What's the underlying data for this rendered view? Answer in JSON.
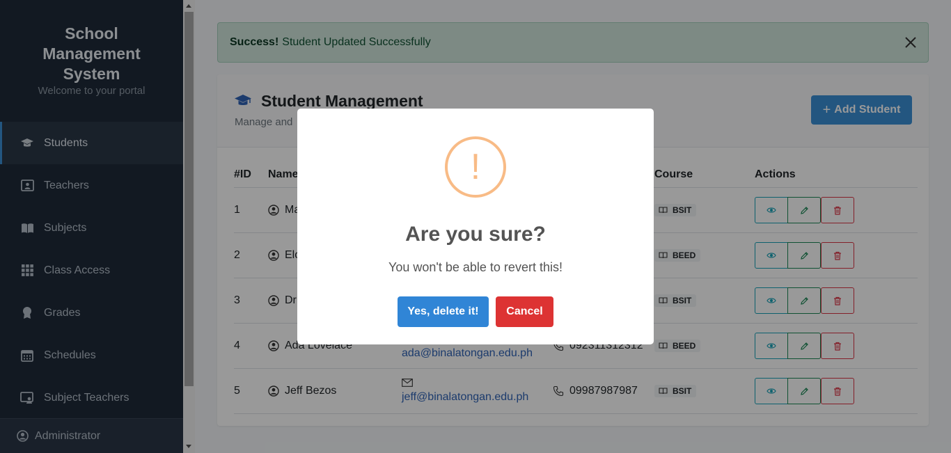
{
  "brand": {
    "title_line1": "School",
    "title_line2": "Management",
    "title_line3": "System",
    "subtitle": "Welcome to your portal"
  },
  "sidebar": {
    "items": [
      {
        "label": "Students",
        "icon": "graduation-cap-icon",
        "active": true
      },
      {
        "label": "Teachers",
        "icon": "teacher-board-icon"
      },
      {
        "label": "Subjects",
        "icon": "book-open-icon"
      },
      {
        "label": "Class Access",
        "icon": "grid-icon"
      },
      {
        "label": "Grades",
        "icon": "award-icon"
      },
      {
        "label": "Schedules",
        "icon": "calendar-icon"
      },
      {
        "label": "Subject Teachers",
        "icon": "monitor-user-icon"
      }
    ],
    "footer_label": "Administrator"
  },
  "alert": {
    "strong": "Success!",
    "message": "Student Updated Successfully"
  },
  "card": {
    "title": "Student Management",
    "subtitle": "Manage and",
    "add_button": "Add Student"
  },
  "table": {
    "headers": {
      "id": "#ID",
      "name": "Name",
      "course": "Course",
      "actions": "Actions"
    },
    "rows": [
      {
        "id": "1",
        "name": "Ma",
        "course": "BSIT"
      },
      {
        "id": "2",
        "name": "Elo",
        "course": "BEED"
      },
      {
        "id": "3",
        "name": "Dr",
        "course": "BSIT"
      },
      {
        "id": "4",
        "name": "Ada Lovelace",
        "email": "ada@binalatongan.edu.ph",
        "phone": "092311312312",
        "course": "BEED"
      },
      {
        "id": "5",
        "name": "Jeff Bezos",
        "email": "jeff@binalatongan.edu.ph",
        "phone": "09987987987",
        "course": "BSIT"
      }
    ]
  },
  "modal": {
    "icon": "!",
    "title": "Are you sure?",
    "text": "You won't be able to revert this!",
    "confirm": "Yes, delete it!",
    "cancel": "Cancel"
  },
  "colors": {
    "sidebar_bg": "#1f2b3a",
    "primary": "#3085d6",
    "danger": "#dd3333",
    "warning_icon": "#f8bb86",
    "success_bg": "#d1e7dd"
  }
}
